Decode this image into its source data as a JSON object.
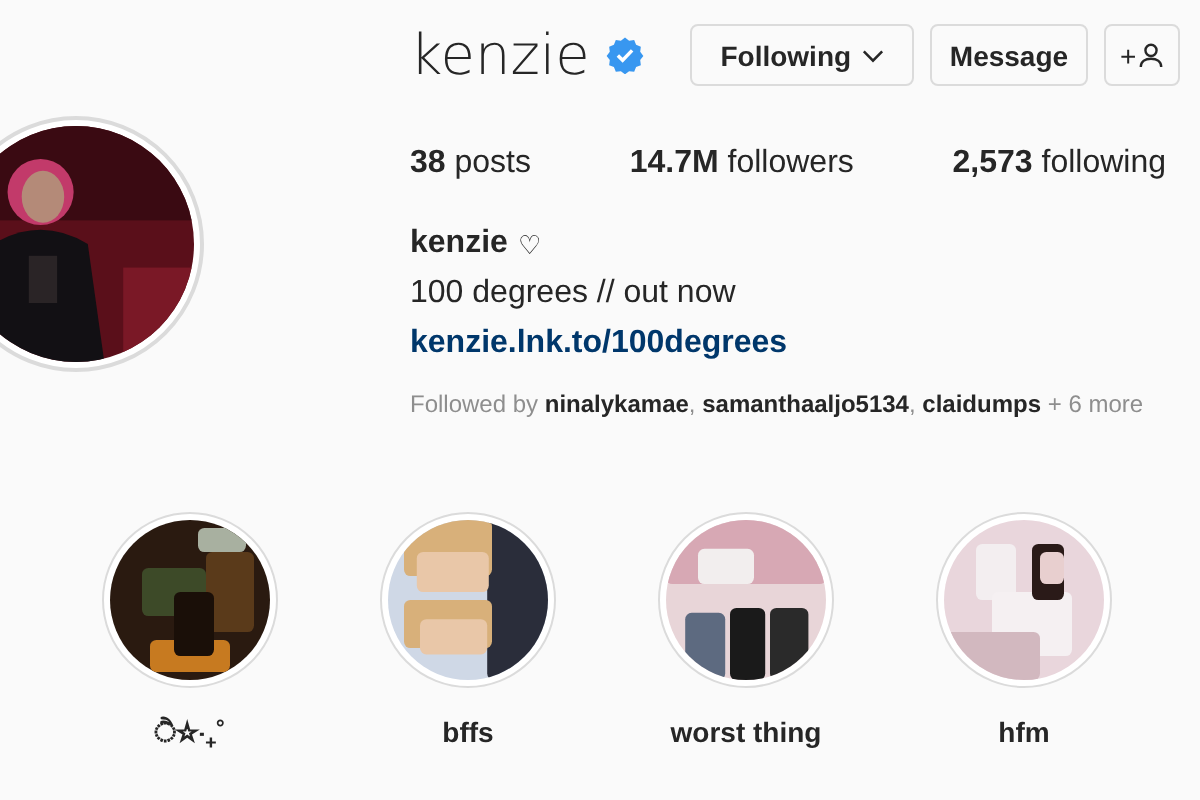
{
  "profile": {
    "username": "kenzie",
    "verified": true
  },
  "buttons": [
    {
      "kind": "dropdown",
      "label": "Following"
    },
    {
      "kind": "text",
      "label": "Message"
    },
    {
      "kind": "icon",
      "label": "+"
    }
  ],
  "stats": [
    {
      "value": "38",
      "label": "posts"
    },
    {
      "value": "14.7M",
      "label": "followers"
    },
    {
      "value": "2,573",
      "label": "following"
    }
  ],
  "bio": {
    "name": "kenzie",
    "name_symbol": "♡",
    "text": "100 degrees // out now",
    "link": "kenzie.lnk.to/100degrees",
    "followed_by": "Followed by **ninalykamae**, **samanthaaljo5134**, **claidumps** + 6 more"
  },
  "highlights": [
    {
      "label": "ੈ☆‧₊˚",
      "kind": "picture"
    },
    {
      "label": "bffs",
      "kind": "picture"
    },
    {
      "label": "worst thing",
      "kind": "picture"
    },
    {
      "label": "hfm",
      "kind": "picture"
    }
  ]
}
